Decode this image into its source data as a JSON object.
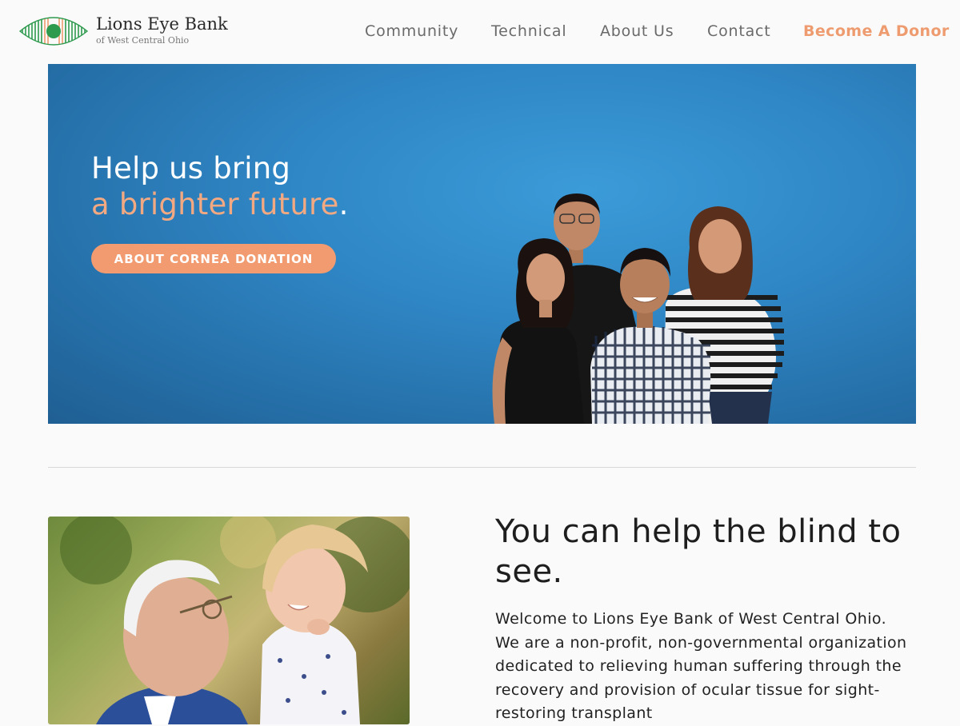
{
  "header": {
    "logo_title": "Lions Eye Bank",
    "logo_subtitle": "of West Central Ohio",
    "logo_icon": "eye-icon"
  },
  "nav": {
    "items": [
      "Community",
      "Technical",
      "About Us",
      "Contact"
    ],
    "cta": "Become A Donor"
  },
  "hero": {
    "line1": "Help us bring",
    "line2": "a brighter future",
    "line2_period": ".",
    "button": "ABOUT CORNEA DONATION"
  },
  "intro": {
    "heading": "You can help the blind to see.",
    "body": "Welcome to Lions Eye Bank of West Central Ohio. We are a non-profit, non-governmental organization dedicated to relieving human suffering through the recovery and provision of ocular tissue for sight-restoring transplant"
  },
  "colors": {
    "accent": "#ee9b6f",
    "hero_blue": "#2f86c4",
    "logo_green": "#2e9a4e",
    "nav_text": "#6a6a6a"
  }
}
